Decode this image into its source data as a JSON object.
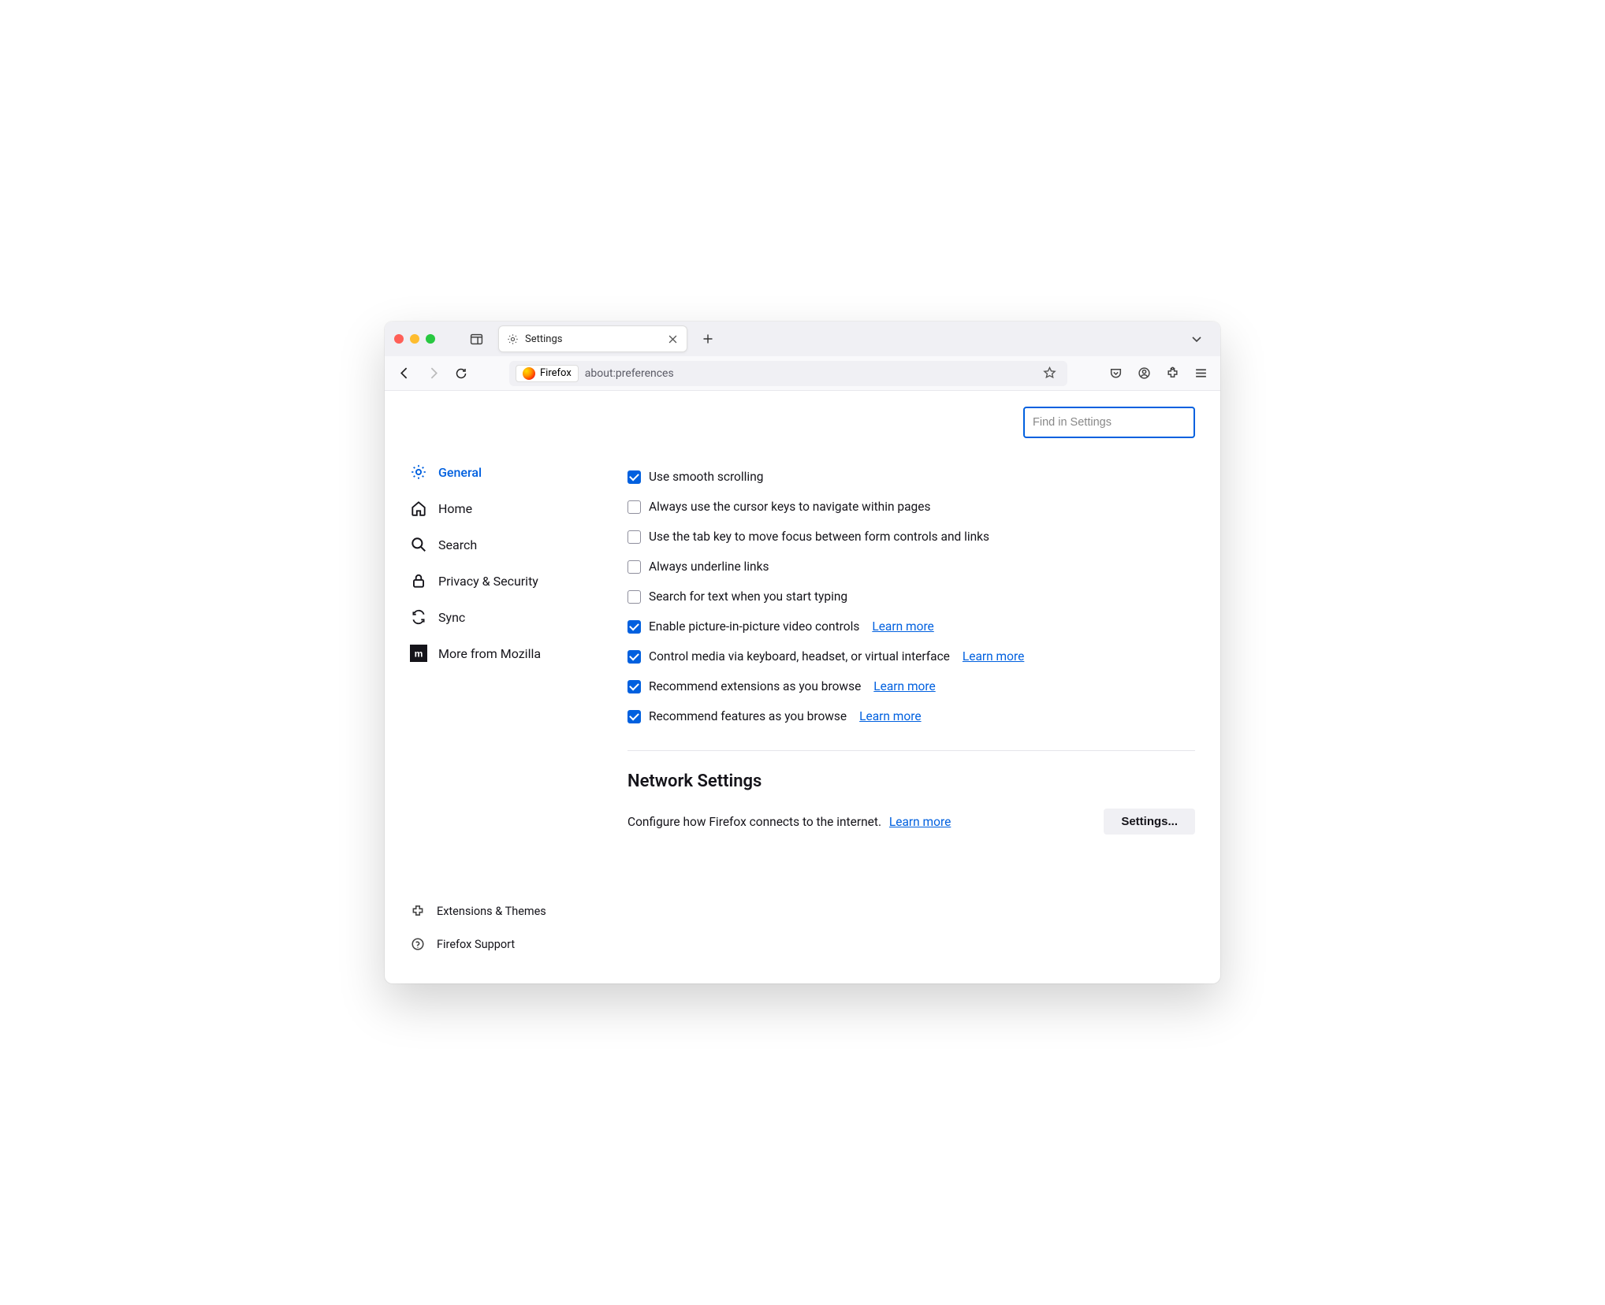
{
  "tabstrip": {
    "tab_title": "Settings"
  },
  "toolbar": {
    "identity_label": "Firefox",
    "url": "about:preferences"
  },
  "search": {
    "placeholder": "Find in Settings",
    "value": ""
  },
  "sidebar": {
    "items": [
      {
        "label": "General"
      },
      {
        "label": "Home"
      },
      {
        "label": "Search"
      },
      {
        "label": "Privacy & Security"
      },
      {
        "label": "Sync"
      },
      {
        "label": "More from Mozilla"
      }
    ],
    "footer": [
      {
        "label": "Extensions & Themes"
      },
      {
        "label": "Firefox Support"
      }
    ]
  },
  "options": [
    {
      "label": "Use smooth scrolling",
      "checked": true
    },
    {
      "label": "Always use the cursor keys to navigate within pages",
      "checked": false
    },
    {
      "label": "Use the tab key to move focus between form controls and links",
      "checked": false
    },
    {
      "label": "Always underline links",
      "checked": false
    },
    {
      "label": "Search for text when you start typing",
      "checked": false
    },
    {
      "label": "Enable picture-in-picture video controls",
      "checked": true,
      "learn_more": "Learn more"
    },
    {
      "label": "Control media via keyboard, headset, or virtual interface",
      "checked": true,
      "learn_more": "Learn more"
    },
    {
      "label": "Recommend extensions as you browse",
      "checked": true,
      "learn_more": "Learn more"
    },
    {
      "label": "Recommend features as you browse",
      "checked": true,
      "learn_more": "Learn more"
    }
  ],
  "network": {
    "title": "Network Settings",
    "desc": "Configure how Firefox connects to the internet.",
    "learn_more": "Learn more",
    "button": "Settings..."
  }
}
